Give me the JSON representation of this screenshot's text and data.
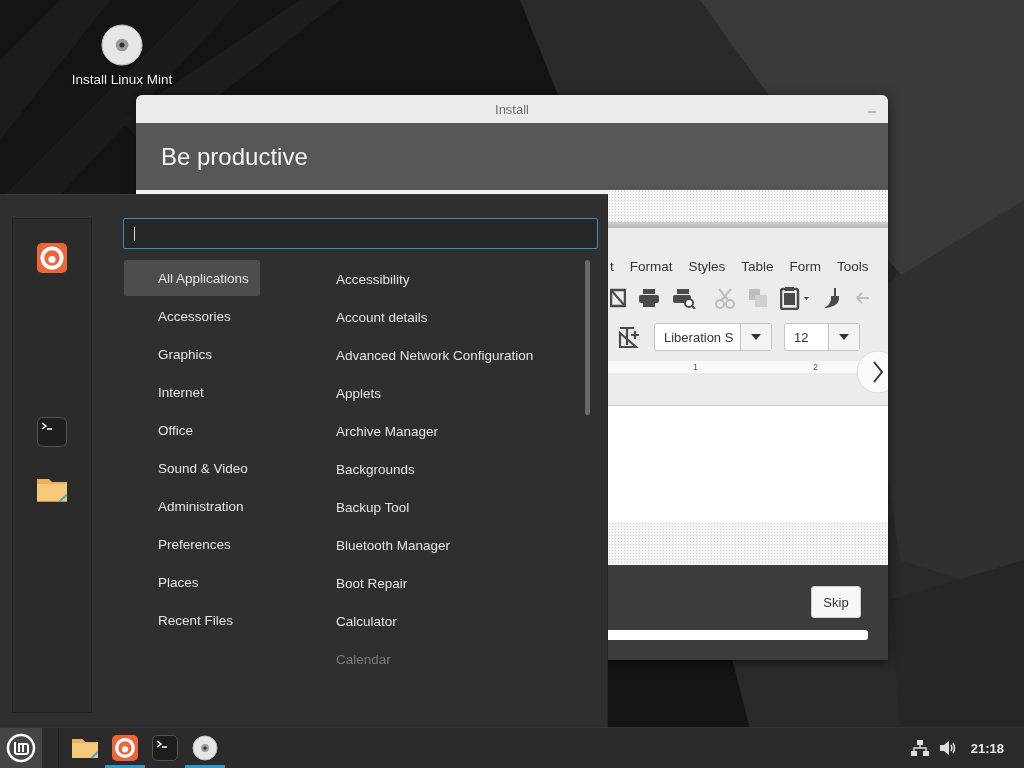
{
  "desktop_icons": [
    {
      "kind": "disc",
      "label": "Install Linux Mint"
    }
  ],
  "install_window": {
    "title": "Install",
    "heading": "Be productive",
    "slide": {
      "menu_items": [
        "t",
        "Format",
        "Styles",
        "Table",
        "Form",
        "Tools"
      ],
      "font_name": "Liberation S",
      "font_size": "12",
      "ruler_labels": [
        "1",
        "2"
      ]
    },
    "skip_button": "Skip",
    "progress": {
      "level": 1
    }
  },
  "menu": {
    "search": {
      "focused": true
    },
    "favorites": [
      {
        "kind": "browser"
      },
      {
        "kind": "gap"
      },
      {
        "kind": "terminal"
      },
      {
        "kind": "folder"
      }
    ],
    "categories": [
      {
        "label": "All Applications",
        "selected": true
      },
      {
        "label": "Accessories",
        "selected": false
      },
      {
        "label": "Graphics",
        "selected": false
      },
      {
        "label": "Internet",
        "selected": false
      },
      {
        "label": "Office",
        "selected": false
      },
      {
        "label": "Sound & Video",
        "selected": false
      },
      {
        "label": "Administration",
        "selected": false
      },
      {
        "label": "Preferences",
        "selected": false
      },
      {
        "label": "Places",
        "selected": false
      },
      {
        "label": "Recent Files",
        "selected": false
      }
    ],
    "applications": [
      {
        "label": "Accessibility",
        "disabled": false
      },
      {
        "label": "Account details",
        "disabled": false
      },
      {
        "label": "Advanced Network Configuration",
        "disabled": false
      },
      {
        "label": "Applets",
        "disabled": false
      },
      {
        "label": "Archive Manager",
        "disabled": false
      },
      {
        "label": "Backgrounds",
        "disabled": false
      },
      {
        "label": "Backup Tool",
        "disabled": false
      },
      {
        "label": "Bluetooth Manager",
        "disabled": false
      },
      {
        "label": "Boot Repair",
        "disabled": false
      },
      {
        "label": "Calculator",
        "disabled": false
      },
      {
        "label": "Calendar",
        "disabled": true
      }
    ]
  },
  "taskbar": {
    "menu_button": {
      "active": true
    },
    "apps": [
      {
        "kind": "folder",
        "running": false
      },
      {
        "kind": "browser",
        "running": true
      },
      {
        "kind": "terminal",
        "running": false
      },
      {
        "kind": "disc",
        "running": true
      }
    ],
    "clock": "21:18"
  }
}
